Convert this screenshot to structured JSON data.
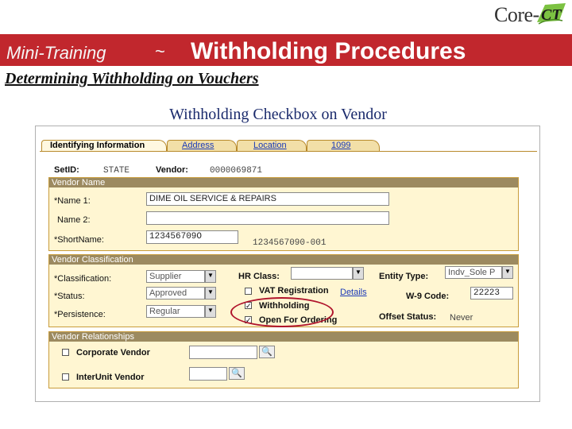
{
  "logo": {
    "text": "Core-",
    "mark": "CT"
  },
  "banner": {
    "mini_label": "Mini-Training",
    "separator": "~",
    "title": "Withholding Procedures"
  },
  "subtitle": "Determining Withholding on Vouchers",
  "caption": "Withholding Checkbox on Vendor",
  "tabs": [
    {
      "label": "Identifying Information",
      "active": true
    },
    {
      "label": "Address",
      "active": false
    },
    {
      "label": "Location",
      "active": false
    },
    {
      "label": "1099",
      "active": false
    }
  ],
  "header": {
    "setid_label": "SetID:",
    "setid_value": "STATE",
    "vendor_label": "Vendor:",
    "vendor_value": "0000069871"
  },
  "vendor_name": {
    "section_title": "Vendor Name",
    "name1_label": "*Name 1:",
    "name1_value": "DIME OIL SERVICE & REPAIRS",
    "name2_label": "Name 2:",
    "name2_value": "",
    "shortname_label": "*ShortName:",
    "shortname_value": "123456709O",
    "shortname_full": "1234567090-001"
  },
  "classification": {
    "section_title": "Vendor Classification",
    "class_label": "*Classification:",
    "class_value": "Supplier",
    "status_label": "*Status:",
    "status_value": "Approved",
    "persistence_label": "*Persistence:",
    "persistence_value": "Regular",
    "hr_class_label": "HR Class:",
    "hr_class_value": "",
    "vat_label": "VAT Registration",
    "vat_checked": false,
    "details_link": "Details",
    "withholding_label": "Withholding",
    "withholding_checked": true,
    "open_ordering_label": "Open For Ordering",
    "open_ordering_checked": true,
    "entity_type_label": "Entity Type:",
    "entity_type_value": "Indv_Sole P",
    "w9_label": "W-9 Code:",
    "w9_value": "22223",
    "offset_label": "Offset Status:",
    "offset_value": "Never"
  },
  "relationships": {
    "section_title": "Vendor Relationships",
    "corporate_label": "Corporate Vendor",
    "corporate_checked": false,
    "interunit_label": "InterUnit Vendor",
    "interunit_checked": false
  },
  "colors": {
    "banner": "#c1272d",
    "section_bg": "#fff6d2",
    "highlight_circle": "#b0142c",
    "link": "#1a3ab8"
  },
  "icons": {
    "dropdown": "chevron-down-icon",
    "lookup": "magnifier-icon"
  }
}
